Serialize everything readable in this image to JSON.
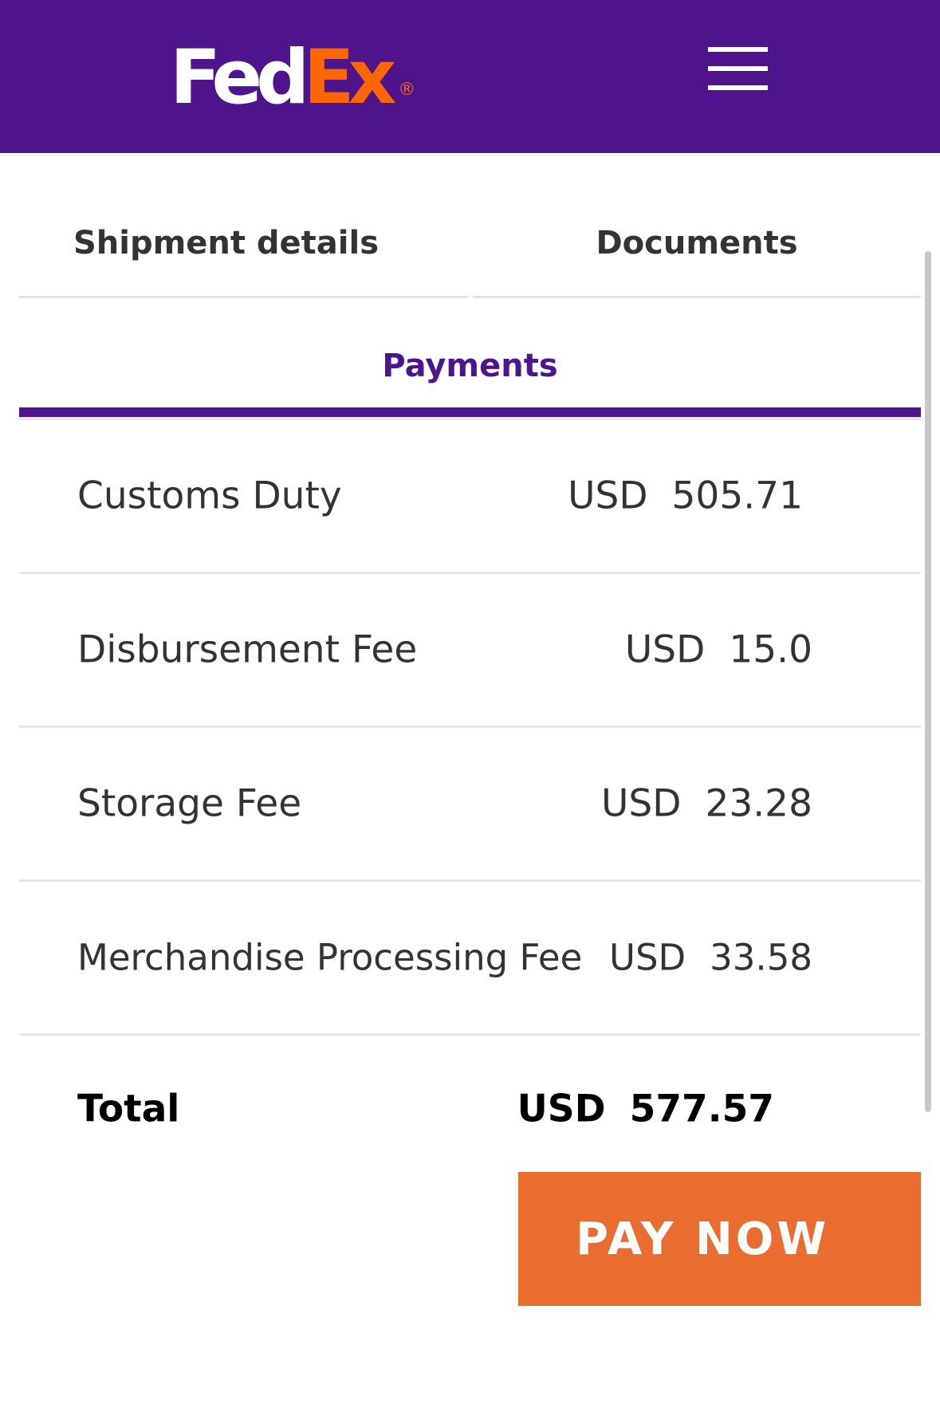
{
  "header": {
    "logo": {
      "fed": "Fed",
      "ex": "Ex",
      "reg": "®"
    },
    "background_color": "#4d148c",
    "menu_icon": "hamburger-menu-icon"
  },
  "tabs": [
    {
      "label": "Shipment details",
      "active": false
    },
    {
      "label": "Documents",
      "active": false
    },
    {
      "label": "Payments",
      "active": true
    }
  ],
  "payments": {
    "fees": [
      {
        "name": "Customs Duty",
        "currency": "USD",
        "amount": "505.71"
      },
      {
        "name": "Disbursement Fee",
        "currency": "USD",
        "amount": "15.0"
      },
      {
        "name": "Storage Fee",
        "currency": "USD",
        "amount": "23.28"
      },
      {
        "name": "Merchandise Processing Fee",
        "currency": "USD",
        "amount": "33.58"
      }
    ],
    "total": {
      "label": "Total",
      "currency": "USD",
      "amount": "577.57"
    },
    "pay_button_label": "PAY NOW"
  },
  "colors": {
    "brand_purple": "#4d148c",
    "brand_orange": "#ff6600",
    "pay_button": "#ea6d30"
  }
}
